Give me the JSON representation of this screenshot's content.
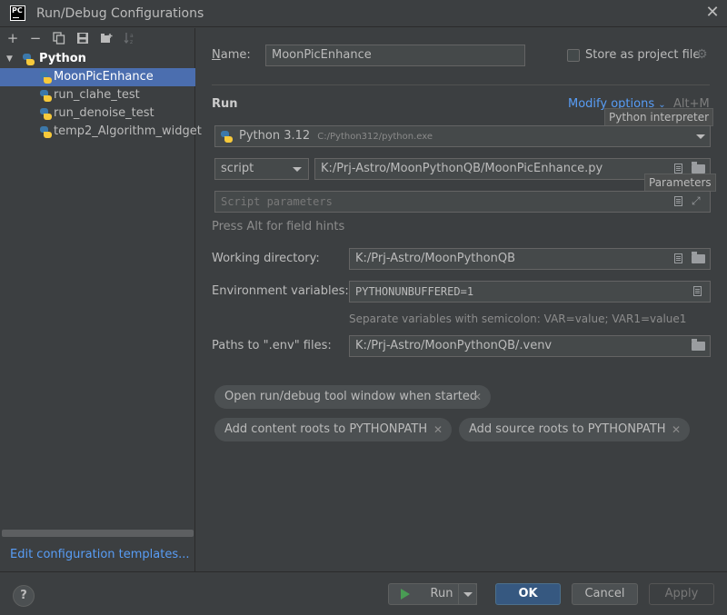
{
  "window": {
    "title": "Run/Debug Configurations",
    "logo_text": "PC"
  },
  "tree": {
    "group_label": "Python",
    "items": [
      {
        "label": "MoonPicEnhance",
        "selected": true
      },
      {
        "label": "run_clahe_test",
        "selected": false
      },
      {
        "label": "run_denoise_test",
        "selected": false
      },
      {
        "label": "temp2_Algorithm_widget",
        "selected": false
      }
    ],
    "edit_templates_link": "Edit configuration templates..."
  },
  "form": {
    "name_label": "Name:",
    "name_value": "MoonPicEnhance",
    "store_label": "Store as project file",
    "run_section": "Run",
    "modify_options": "Modify options",
    "modify_shortcut": "Alt+M",
    "interpreter_tooltip": "Python interpreter",
    "interpreter_name": "Python 3.12",
    "interpreter_path": "C:/Python312/python.exe",
    "script_type": "script",
    "script_path": "K:/Prj-Astro/MoonPythonQB/MoonPicEnhance.py",
    "parameters_tooltip": "Parameters",
    "script_params_placeholder": "Script parameters",
    "alt_hint": "Press Alt for field hints",
    "workdir_label": "Working directory:",
    "workdir_value": "K:/Prj-Astro/MoonPythonQB",
    "env_label": "Environment variables:",
    "env_value": "PYTHONUNBUFFERED=1",
    "env_hint": "Separate variables with semicolon: VAR=value; VAR1=value1",
    "dotenv_label": "Paths to \".env\" files:",
    "dotenv_value": "K:/Prj-Astro/MoonPythonQB/.venv",
    "chips": [
      "Open run/debug tool window when started",
      "Add content roots to PYTHONPATH",
      "Add source roots to PYTHONPATH"
    ]
  },
  "buttons": {
    "help": "?",
    "run": "Run",
    "ok": "OK",
    "cancel": "Cancel",
    "apply": "Apply"
  },
  "colors": {
    "background": "#3c3f41",
    "selection": "#4b6eaf",
    "link": "#589df6",
    "ok": "#365880"
  }
}
